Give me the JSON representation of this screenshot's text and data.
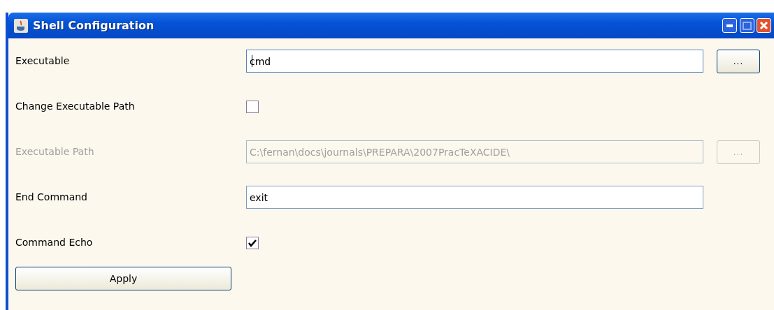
{
  "window": {
    "title": "Shell Configuration"
  },
  "rows": [
    {
      "kind": "text",
      "label": "Executable",
      "value": "cmd",
      "disabled": false,
      "focused": true,
      "browse": "..."
    },
    {
      "kind": "checkbox",
      "label": "Change Executable Path",
      "checked": false
    },
    {
      "kind": "text",
      "label": "Executable Path",
      "value": "C:\\fernan\\docs\\journals\\PREPARA\\2007PracTeXACIDE\\",
      "disabled": true,
      "focused": false,
      "browse": "..."
    },
    {
      "kind": "text",
      "label": "End Command",
      "value": "exit",
      "disabled": false,
      "focused": false
    },
    {
      "kind": "checkbox",
      "label": "Command Echo",
      "checked": true
    }
  ],
  "apply_button": "Apply"
}
